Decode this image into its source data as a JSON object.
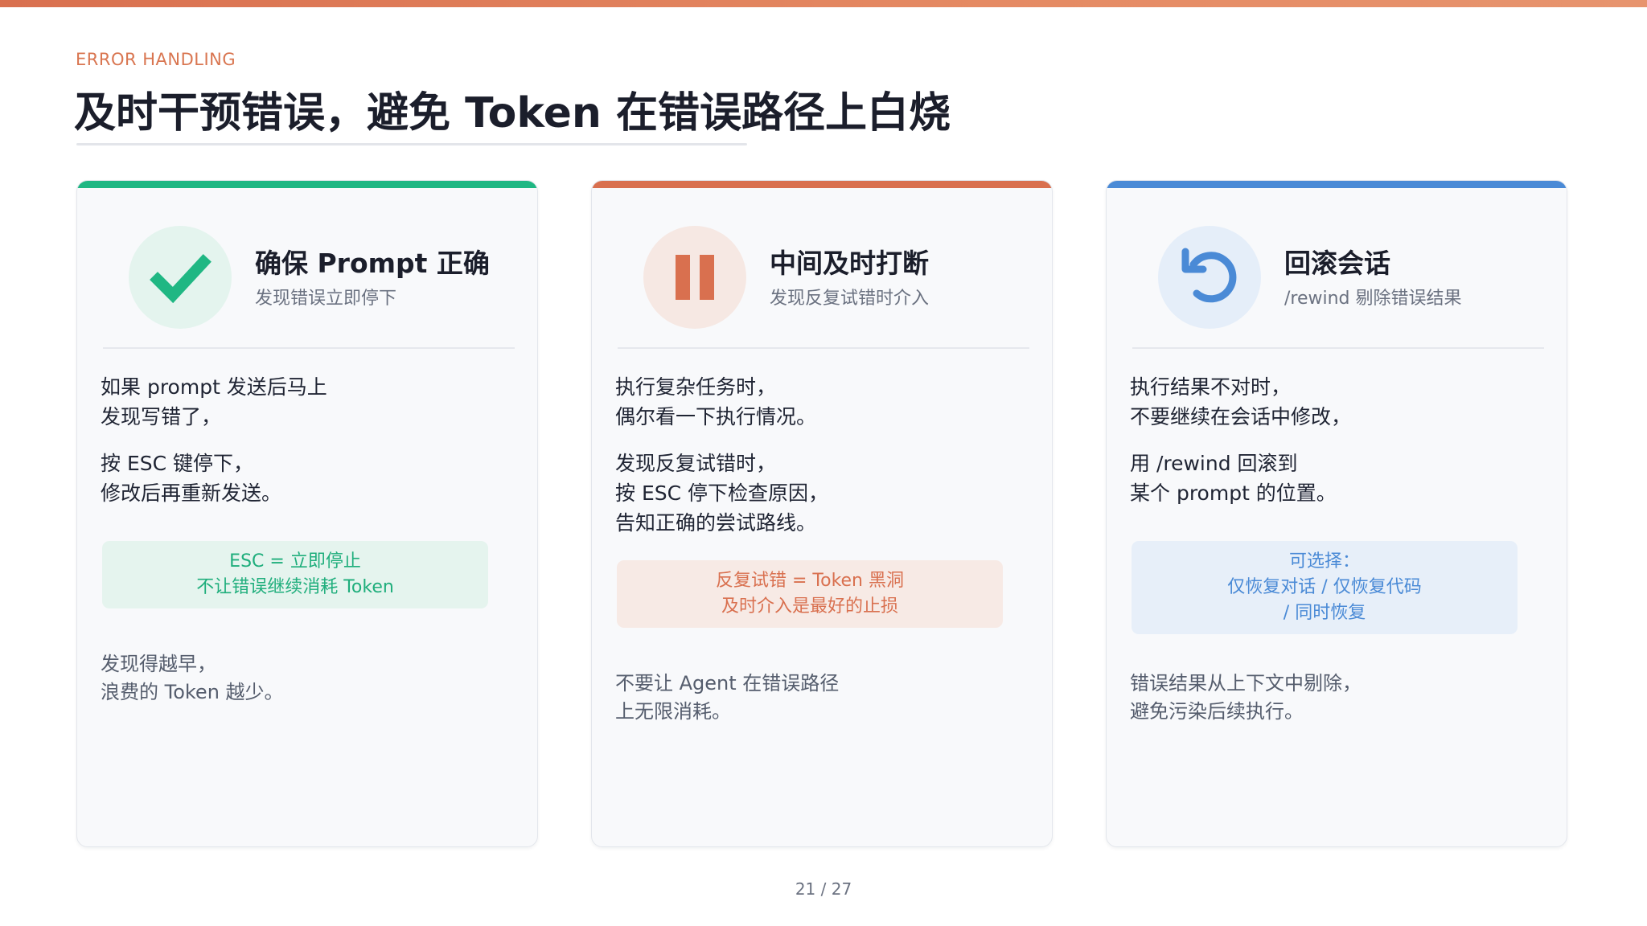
{
  "slide": {
    "eyebrow": "ERROR HANDLING",
    "title": "及时干预错误，避免 Token 在错误路径上白烧",
    "page_number": "21 / 27"
  },
  "colors": {
    "green": "#1fb783",
    "orange": "#d9704f",
    "blue": "#4a8ad6"
  },
  "cards": [
    {
      "title": "确保 Prompt 正确",
      "subtitle": "发现错误立即停下",
      "icon": "checkmark-icon",
      "body": [
        "如果 prompt 发送后马上\n发现写错了，",
        "按 ESC 键停下，\n修改后再重新发送。"
      ],
      "callout": "ESC = 立即停止\n不让错误继续消耗 Token",
      "footnote": "发现得越早，\n浪费的 Token 越少。"
    },
    {
      "title": "中间及时打断",
      "subtitle": "发现反复试错时介入",
      "icon": "pause-icon",
      "body": [
        "执行复杂任务时，\n偶尔看一下执行情况。",
        "发现反复试错时，\n按 ESC 停下检查原因，\n告知正确的尝试路线。"
      ],
      "callout": "反复试错 = Token 黑洞\n及时介入是最好的止损",
      "footnote": "不要让 Agent 在错误路径\n上无限消耗。"
    },
    {
      "title": "回滚会话",
      "subtitle": "/rewind 剔除错误结果",
      "icon": "rewind-icon",
      "body": [
        "执行结果不对时，\n不要继续在会话中修改，",
        "用 /rewind 回滚到\n某个 prompt 的位置。"
      ],
      "callout": "可选择：\n仅恢复对话 / 仅恢复代码\n/ 同时恢复",
      "footnote": "错误结果从上下文中剔除，\n避免污染后续执行。"
    }
  ]
}
